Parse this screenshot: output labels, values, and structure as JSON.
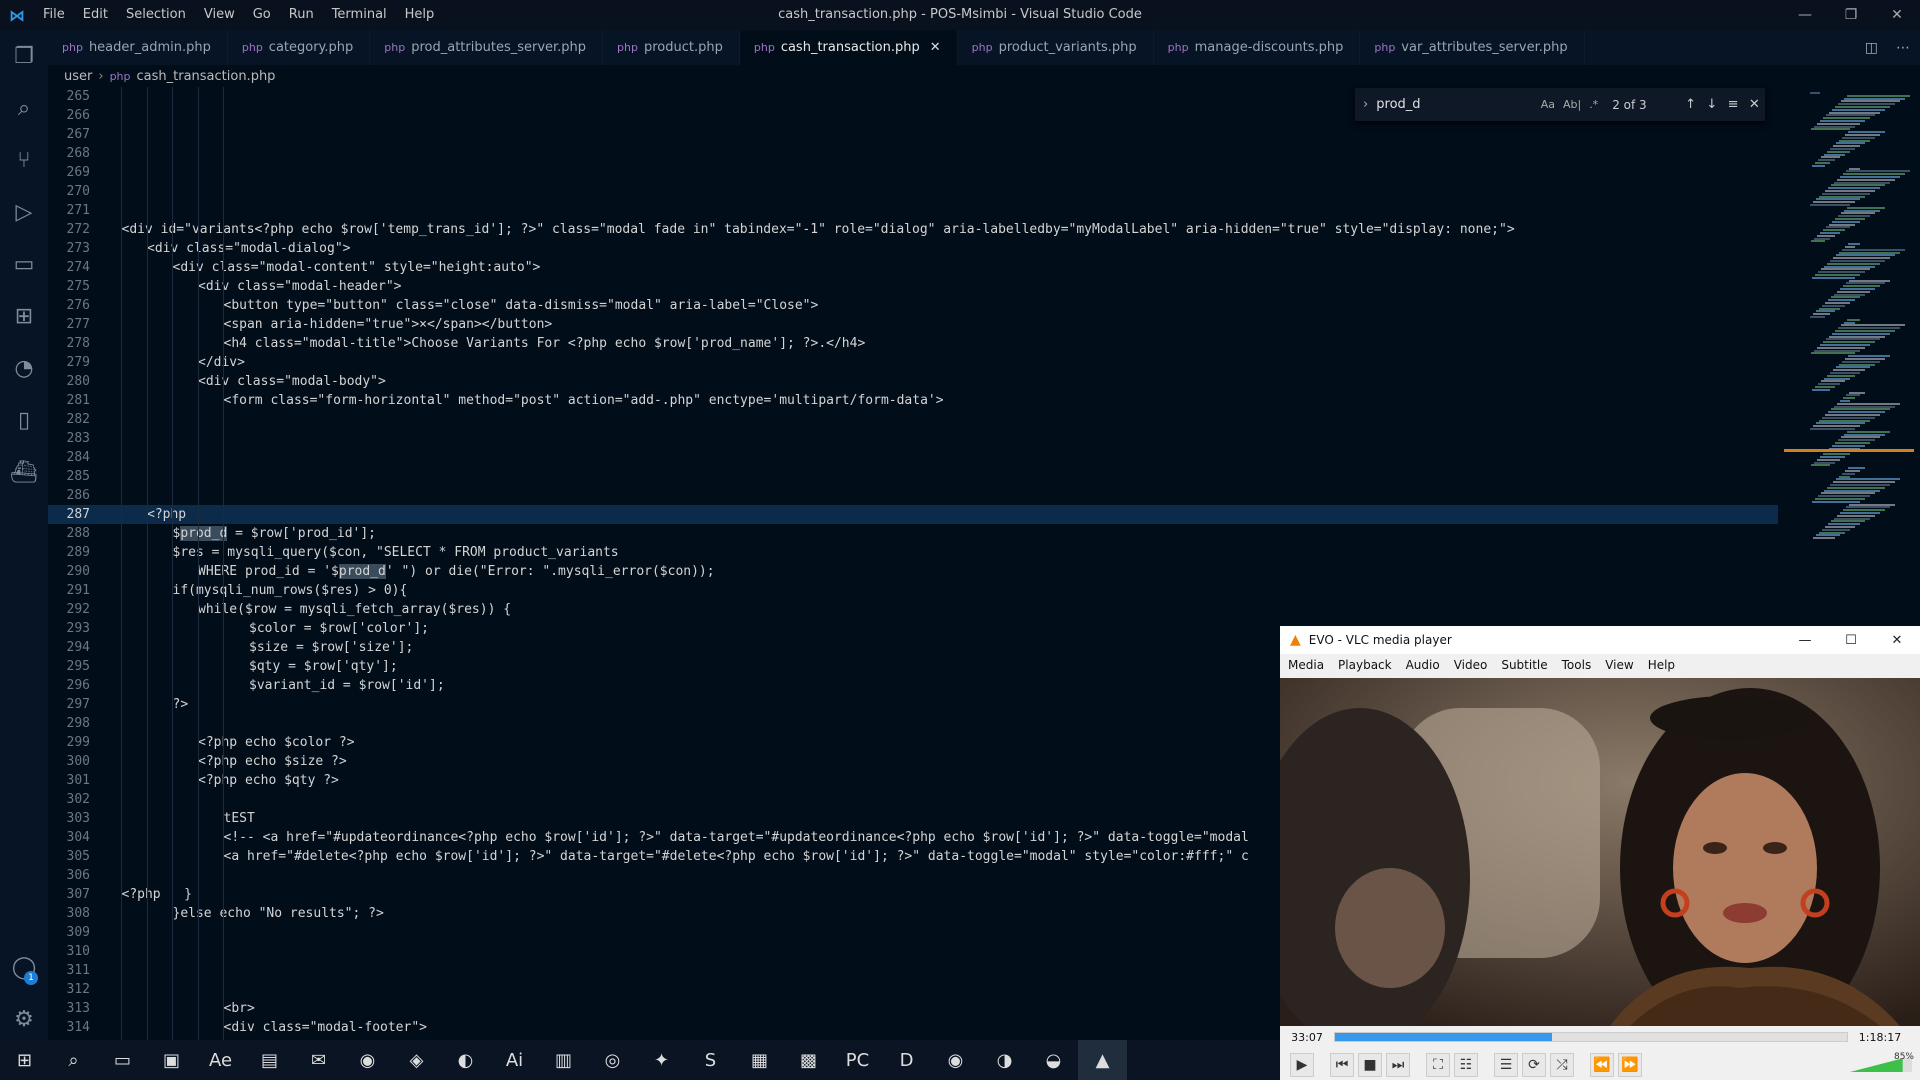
{
  "titlebar": {
    "menu": [
      "File",
      "Edit",
      "Selection",
      "View",
      "Go",
      "Run",
      "Terminal",
      "Help"
    ],
    "window_title": "cash_transaction.php - POS-Msimbi - Visual Studio Code",
    "minimize": "—",
    "restore": "❐",
    "close": "✕"
  },
  "activity": {
    "badge_count": "1"
  },
  "tabs": [
    {
      "label": "header_admin.php"
    },
    {
      "label": "category.php"
    },
    {
      "label": "prod_attributes_server.php"
    },
    {
      "label": "product.php"
    },
    {
      "label": "cash_transaction.php",
      "active": true
    },
    {
      "label": "product_variants.php"
    },
    {
      "label": "manage-discounts.php"
    },
    {
      "label": "var_attributes_server.php"
    }
  ],
  "tab_close": "✕",
  "breadcrumb": {
    "folder": "user",
    "file": "cash_transaction.php"
  },
  "find": {
    "query": "prod_d",
    "match_case": "Aa",
    "whole_word": "Ab|",
    "regex": ".*",
    "count": "2 of 3"
  },
  "editor": {
    "current_line": 287,
    "lines": [
      {
        "n": "265",
        "code": ""
      },
      {
        "n": "266",
        "code": ""
      },
      {
        "n": "267",
        "code": ""
      },
      {
        "n": "268",
        "code": ""
      },
      {
        "n": "269",
        "code": ""
      },
      {
        "n": "270",
        "code": ""
      },
      {
        "n": "271",
        "code": ""
      },
      {
        "n": "272",
        "code": "<div id=\"variants<?php echo $row['temp_trans_id']; ?>\" class=\"modal fade in\" tabindex=\"-1\" role=\"dialog\" aria-labelledby=\"myModalLabel\" aria-hidden=\"true\" style=\"display: none;\">",
        "indent": 1
      },
      {
        "n": "273",
        "code": "<div class=\"modal-dialog\">",
        "indent": 2
      },
      {
        "n": "274",
        "code": "<div class=\"modal-content\" style=\"height:auto\">",
        "indent": 3
      },
      {
        "n": "275",
        "code": "<div class=\"modal-header\">",
        "indent": 4
      },
      {
        "n": "276",
        "code": "<button type=\"button\" class=\"close\" data-dismiss=\"modal\" aria-label=\"Close\">",
        "indent": 5
      },
      {
        "n": "277",
        "code": "<span aria-hidden=\"true\">×</span></button>",
        "indent": 5
      },
      {
        "n": "278",
        "code": "<h4 class=\"modal-title\">Choose Variants For <?php echo $row['prod_name']; ?>.</h4>",
        "indent": 5
      },
      {
        "n": "279",
        "code": "</div>",
        "indent": 4
      },
      {
        "n": "280",
        "code": "<div class=\"modal-body\">",
        "indent": 4
      },
      {
        "n": "281",
        "code": "<form class=\"form-horizontal\" method=\"post\" action=\"add-.php\" enctype='multipart/form-data'>",
        "indent": 5
      },
      {
        "n": "282",
        "code": ""
      },
      {
        "n": "283",
        "code": ""
      },
      {
        "n": "284",
        "code": ""
      },
      {
        "n": "285",
        "code": ""
      },
      {
        "n": "286",
        "code": ""
      },
      {
        "n": "287",
        "code": "<?php",
        "indent": 2
      },
      {
        "n": "288",
        "code": "$prod_d = $row['prod_id'];",
        "indent": 3
      },
      {
        "n": "289",
        "code": "$res = mysqli_query($con, \"SELECT * FROM product_variants",
        "indent": 3
      },
      {
        "n": "290",
        "code": "WHERE prod_id = '$prod_d' \") or die(\"Error: \".mysqli_error($con));",
        "indent": 4
      },
      {
        "n": "291",
        "code": "if(mysqli_num_rows($res) > 0){",
        "indent": 3
      },
      {
        "n": "292",
        "code": "while($row = mysqli_fetch_array($res)) {",
        "indent": 4
      },
      {
        "n": "293",
        "code": "$color = $row['color'];",
        "indent": 6
      },
      {
        "n": "294",
        "code": "$size = $row['size'];",
        "indent": 6
      },
      {
        "n": "295",
        "code": "$qty = $row['qty'];",
        "indent": 6
      },
      {
        "n": "296",
        "code": "$variant_id = $row['id'];",
        "indent": 6
      },
      {
        "n": "297",
        "code": "?>",
        "indent": 3
      },
      {
        "n": "298",
        "code": ""
      },
      {
        "n": "299",
        "code": "<?php echo $color ?>",
        "indent": 4
      },
      {
        "n": "300",
        "code": "<?php echo $size ?>",
        "indent": 4
      },
      {
        "n": "301",
        "code": "<?php echo $qty ?>",
        "indent": 4
      },
      {
        "n": "302",
        "code": ""
      },
      {
        "n": "303",
        "code": "tEST",
        "indent": 5
      },
      {
        "n": "304",
        "code": "<!-- <a href=\"#updateordinance<?php echo $row['id']; ?>\" data-target=\"#updateordinance<?php echo $row['id']; ?>\" data-toggle=\"modal",
        "indent": 5
      },
      {
        "n": "305",
        "code": "<a href=\"#delete<?php echo $row['id']; ?>\" data-target=\"#delete<?php echo $row['id']; ?>\" data-toggle=\"modal\" style=\"color:#fff;\" c",
        "indent": 5
      },
      {
        "n": "306",
        "code": ""
      },
      {
        "n": "307",
        "code": "<?php   }",
        "indent": 1
      },
      {
        "n": "308",
        "code": "}else echo \"No results\"; ?>",
        "indent": 3
      },
      {
        "n": "309",
        "code": ""
      },
      {
        "n": "310",
        "code": ""
      },
      {
        "n": "311",
        "code": ""
      },
      {
        "n": "312",
        "code": ""
      },
      {
        "n": "313",
        "code": "<br>",
        "indent": 5
      },
      {
        "n": "314",
        "code": "<div class=\"modal-footer\">",
        "indent": 5
      }
    ]
  },
  "vlc": {
    "title": "EVO - VLC media player",
    "menu": [
      "Media",
      "Playback",
      "Audio",
      "Video",
      "Subtitle",
      "Tools",
      "View",
      "Help"
    ],
    "elapsed": "33:07",
    "total": "1:18:17",
    "progress_fraction": 0.423,
    "volume": "85%",
    "volume_fraction": 0.85
  },
  "taskbar": {
    "apps": [
      "start-icon",
      "search-icon",
      "task-view-icon",
      "file-explorer-icon",
      "after-effects-icon",
      "store-icon",
      "mail-icon",
      "chrome-icon",
      "vscode-icon",
      "edge-icon",
      "illustrator-icon",
      "document-icon",
      "media-icon",
      "twitter-icon",
      "skype-icon",
      "equalizer-icon",
      "office-icon",
      "pycharm-icon",
      "app-d-icon",
      "chrome-icon-2",
      "browser-icon",
      "firefox-icon",
      "vlc-icon"
    ],
    "glyphs": [
      "⊞",
      "⌕",
      "▭",
      "▣",
      "Ae",
      "▤",
      "✉",
      "◉",
      "◈",
      "◐",
      "Ai",
      "▥",
      "◎",
      "✦",
      "S",
      "▦",
      "▩",
      "PC",
      "D",
      "◉",
      "◑",
      "◒",
      "▲"
    ]
  },
  "colors": {
    "editor_bg": "#020d1a",
    "current_line": "#0c2a4a",
    "accent": "#2f9ae8",
    "vlc_progress": "#3898ec"
  }
}
